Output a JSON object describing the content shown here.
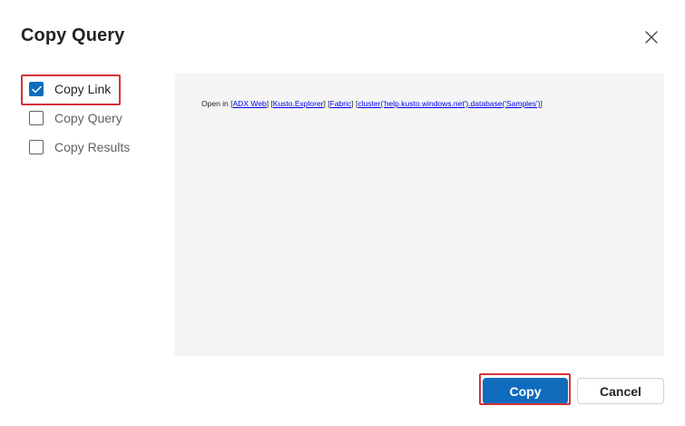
{
  "dialog": {
    "title": "Copy Query",
    "close_icon": "close-icon"
  },
  "options": [
    {
      "label": "Copy Link",
      "checked": true
    },
    {
      "label": "Copy Query",
      "checked": false
    },
    {
      "label": "Copy Results",
      "checked": false
    }
  ],
  "preview": {
    "prefix": "Open in",
    "links": {
      "adx_web": "ADX Web",
      "kusto_explorer": "Kusto.Explorer",
      "fabric": "Fabric",
      "cluster": "cluster('help.kusto.windows.net').database('Samples')"
    }
  },
  "footer": {
    "copy_label": "Copy",
    "cancel_label": "Cancel"
  },
  "colors": {
    "accent": "#0f6cbd",
    "highlight": "#d13438",
    "preview_bg": "#f5f5f5"
  }
}
